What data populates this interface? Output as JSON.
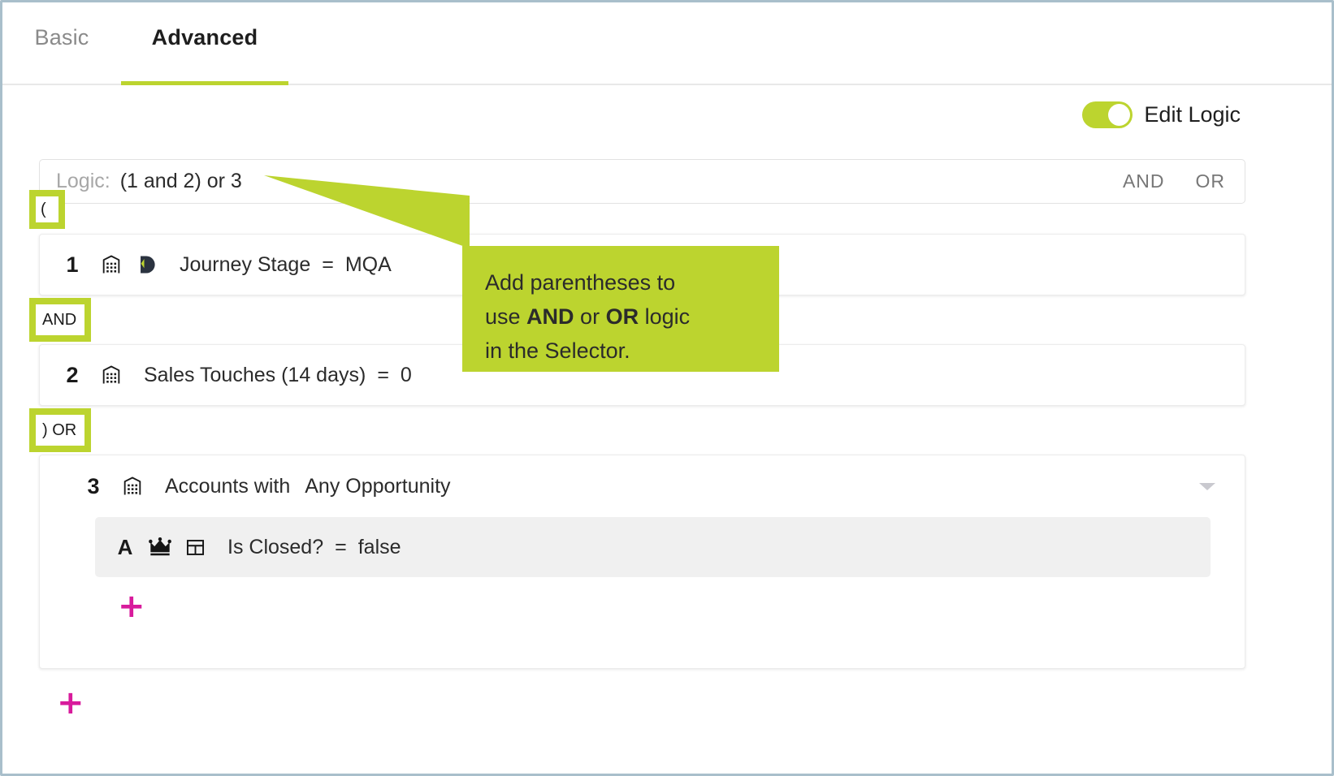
{
  "tabs": [
    {
      "label": "Basic",
      "active": false
    },
    {
      "label": "Advanced",
      "active": true
    }
  ],
  "toggle": {
    "label": "Edit Logic",
    "state": "on",
    "accent_color": "#bcd42f"
  },
  "logic_bar": {
    "label": "Logic:",
    "value": "(1 and 2) or 3",
    "operators": [
      "AND",
      "OR"
    ]
  },
  "highlight_chips": {
    "open_paren": "(",
    "and": "AND",
    "close_paren_or": ") OR"
  },
  "conditions": [
    {
      "number": "1",
      "icons": [
        "building-icon",
        "demandbase-d-icon"
      ],
      "field": "Journey Stage",
      "operator": "=",
      "value": "MQA"
    },
    {
      "number": "2",
      "icons": [
        "building-icon"
      ],
      "field": "Sales Touches (14 days)",
      "operator": "=",
      "value": "0"
    },
    {
      "number": "3",
      "icons": [
        "building-icon"
      ],
      "field": "Accounts with",
      "operator": "",
      "value": "Any Opportunity",
      "has_caret": true,
      "subconditions": [
        {
          "letter": "A",
          "icons": [
            "crown-icon",
            "table-grid-icon"
          ],
          "field": "Is Closed?",
          "operator": "=",
          "value": "false"
        }
      ],
      "add_label": "+"
    }
  ],
  "add_condition_label": "+",
  "callout": {
    "line1_prefix": "Add parentheses to",
    "line2_prefix": "use ",
    "line2_bold1": "AND",
    "line2_mid": " or ",
    "line2_bold2": "OR",
    "line2_suffix": " logic",
    "line3": "in the Selector.",
    "background_color": "#bcd42f"
  },
  "colors": {
    "accent_lime": "#bcd42f",
    "plus_pink": "#d81b9c",
    "frame_border": "#a9bfcb"
  }
}
